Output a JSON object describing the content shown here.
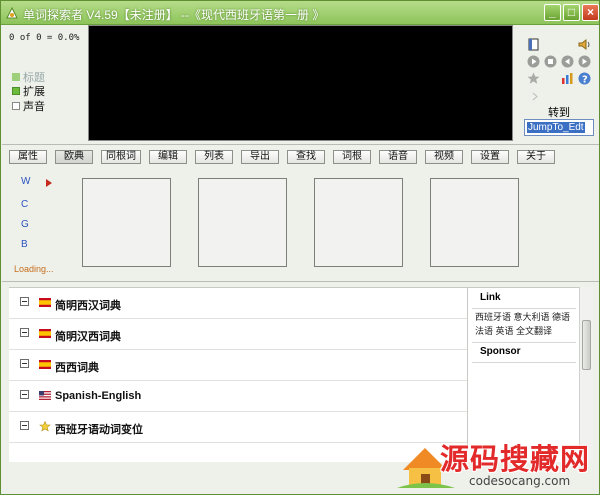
{
  "window": {
    "title": "单词探索者 V4.59【未注册】 --《现代西班牙语第一册 》",
    "min_label": "_",
    "max_label": "□",
    "close_label": "×"
  },
  "status": {
    "progress": "0 of 0 = 0.0%"
  },
  "options": [
    {
      "label": "标题",
      "checked": true,
      "disabled": true
    },
    {
      "label": "扩展",
      "checked": true,
      "disabled": false
    },
    {
      "label": "声音",
      "checked": false,
      "disabled": false
    }
  ],
  "controls": {
    "goto_label": "转到",
    "jump_value": "JumpTo_Edt",
    "icons": [
      "book-icon",
      "speaker-icon",
      "play-icon",
      "stop-icon",
      "previous-icon",
      "next-icon",
      "star-icon",
      "chart-icon",
      "question-icon"
    ]
  },
  "tabs": [
    "属性",
    "欧典",
    "同根词",
    "编辑",
    "列表",
    "导出",
    "查找",
    "词根",
    "语音",
    "视频",
    "设置",
    "关于"
  ],
  "side_letters": [
    "W",
    "C",
    "G",
    "B"
  ],
  "loading_text": "Loading...",
  "dictionaries": [
    {
      "name": "简明西汉词典",
      "flag": "spain-flag"
    },
    {
      "name": "简明汉西词典",
      "flag": "spain-flag"
    },
    {
      "name": "西西词典",
      "flag": "spain-flag"
    },
    {
      "name": "Spanish-English",
      "flag": "us-flag"
    },
    {
      "name": "西班牙语动词变位",
      "flag": "star-icon"
    }
  ],
  "link_panel": {
    "title": "Link",
    "links_line1": "西班牙语 意大利语 德语",
    "links_line2": "法语 英语 全文翻译",
    "sponsor_title": "Sponsor"
  },
  "watermark": {
    "text": "源码搜藏网",
    "url": "codesocang.com"
  },
  "colors": {
    "title_green": "#8dc45a",
    "accent_red": "#e32a2a",
    "link_blue": "#2a54c0"
  }
}
